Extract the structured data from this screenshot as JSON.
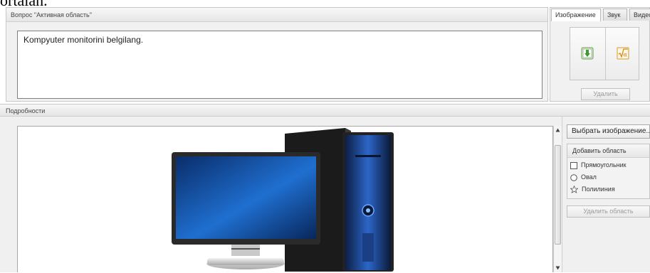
{
  "header_fragment": "ortalan.",
  "question_panel": {
    "title": "Вопрос \"Активная область\"",
    "text": "Kompyuter monitorini belgilang."
  },
  "media_panel": {
    "tabs": [
      {
        "label": "Изображение",
        "active": true
      },
      {
        "label": "Звук",
        "active": false
      },
      {
        "label": "Видео",
        "active": false
      }
    ],
    "icons": [
      "insert-image-icon",
      "insert-formula-icon"
    ],
    "delete_label": "Удалить"
  },
  "details_panel": {
    "title": "Подробности",
    "image": "computer-monitor-and-blue-tower",
    "select_image_label": "Выбрать изображение...",
    "add_area": {
      "title": "Добавить область",
      "items": [
        {
          "label": "Прямоугольник",
          "icon": "square-icon"
        },
        {
          "label": "Овал",
          "icon": "circle-icon"
        },
        {
          "label": "Полилиния",
          "icon": "star-icon"
        }
      ]
    },
    "delete_area_label": "Удалить область"
  },
  "colors": {
    "accent_blue": "#1f5fb8",
    "monitor_frame": "#2a2a2a"
  }
}
